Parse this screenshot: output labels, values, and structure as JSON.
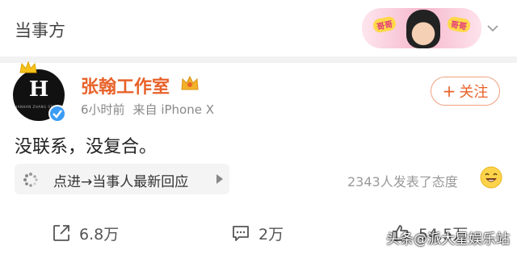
{
  "header": {
    "title": "当事方",
    "banner_tag_left": "哥哥",
    "banner_tag_right": "哥哥",
    "chevron_icon": "chevron-down-icon"
  },
  "post": {
    "avatar_letter": "H",
    "avatar_subtext": "HANHAN ZHANG STUDIO",
    "username": "张翰工作室",
    "time": "6小时前",
    "source": "来自 iPhone X",
    "follow_label": "关注",
    "text": "没联系，没复合。",
    "topic_link": "点进→当事人最新回应",
    "attitude_text": "2343人发表了态度",
    "username_color": "#e8622a",
    "verified_color": "#3b9cf5"
  },
  "actions": {
    "share_count": "6.8万",
    "comment_count": "2万",
    "like_count": "54.5万"
  },
  "watermark": "头条@派大星娱乐站"
}
